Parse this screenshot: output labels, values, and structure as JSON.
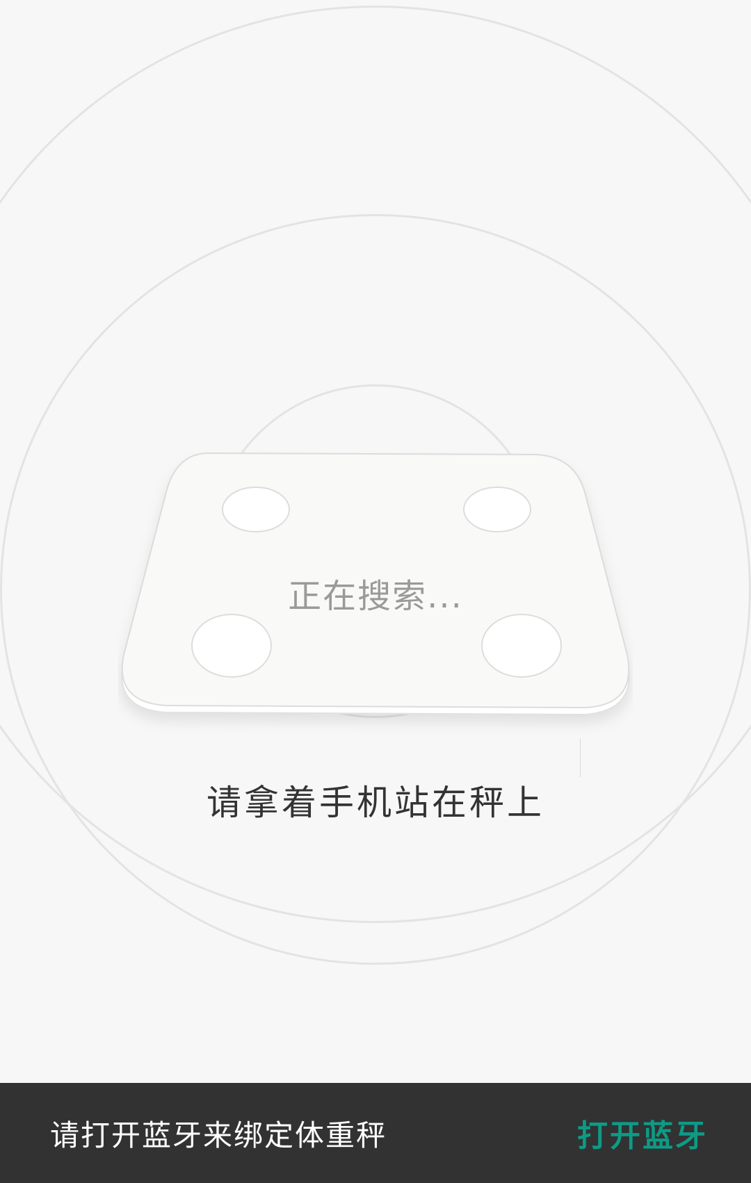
{
  "screen": {
    "status_text": "正在搜索...",
    "instruction": "请拿着手机站在秤上"
  },
  "scale_illustration": {
    "icon": "body-scale-icon",
    "foot_pads": 4
  },
  "snackbar": {
    "message": "请打开蓝牙来绑定体重秤",
    "action_label": "打开蓝牙",
    "action_color": "#0d9b86",
    "background_color": "#323232"
  },
  "colors": {
    "background": "#f7f7f7",
    "ripple": "#e3e3e3",
    "scale_body": "#f9f9f7"
  }
}
